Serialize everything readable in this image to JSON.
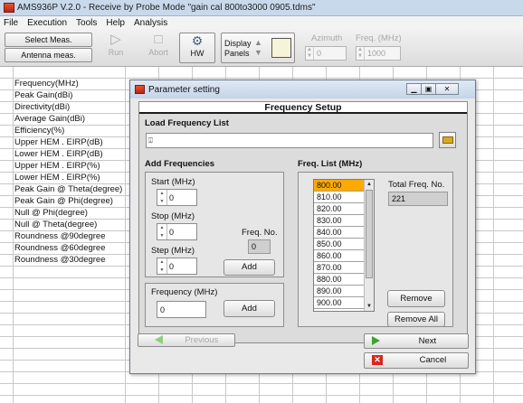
{
  "window": {
    "title": "AMS936P V.2.0 - Receive by Probe Mode \"gain cal 800to3000 0905.tdms\""
  },
  "menu": [
    "File",
    "Execution",
    "Tools",
    "Help",
    "Analysis"
  ],
  "toolbar": {
    "select_meas": "Select Meas.",
    "antenna_meas": "Antenna meas.",
    "run": "Run",
    "abort": "Abort",
    "hw": "HW",
    "display_panels_line1": "Display",
    "display_panels_line2": "Panels",
    "azimuth_label": "Azimuth",
    "azimuth_value": "0",
    "freq_label": "Freq. (MHz)",
    "freq_value": "1000"
  },
  "row_labels": [
    "Frequency(MHz)",
    "Peak Gain(dBi)",
    "Directivity(dBi)",
    "Average Gain(dBi)",
    "Efficiency(%)",
    "Upper HEM . EIRP(dB)",
    "Lower HEM . EIRP(dB)",
    "Upper HEM . EIRP(%)",
    "Lower HEM . EIRP(%)",
    "Peak Gain @ Theta(degree)",
    "Peak Gain @ Phi(degree)",
    "Null @ Phi(degree)",
    "Null @ Theta(degree)",
    "Roundness @90degree",
    "Roundness @60degree",
    "Roundness @30degree"
  ],
  "dialog": {
    "title": "Parameter setting",
    "header": "Frequency Setup",
    "load_label": "Load Frequency List",
    "path_value": "",
    "add_freq_label": "Add Frequencies",
    "start_label": "Start (MHz)",
    "start_value": "0",
    "stop_label": "Stop (MHz)",
    "stop_value": "0",
    "step_label": "Step (MHz)",
    "step_value": "0",
    "freq_no_label": "Freq. No.",
    "freq_no_value": "0",
    "add_label": "Add",
    "frequency_label": "Frequency (MHz)",
    "frequency_value": "0",
    "add2_label": "Add",
    "freq_list_label": "Freq. List (MHz)",
    "freq_list": [
      "800.00",
      "810.00",
      "820.00",
      "830.00",
      "840.00",
      "850.00",
      "860.00",
      "870.00",
      "880.00",
      "890.00",
      "900.00"
    ],
    "total_label": "Total Freq. No.",
    "total_value": "221",
    "remove_label": "Remove",
    "remove_all_label": "Remove All",
    "previous_label": "Previous",
    "next_label": "Next",
    "cancel_label": "Cancel"
  }
}
